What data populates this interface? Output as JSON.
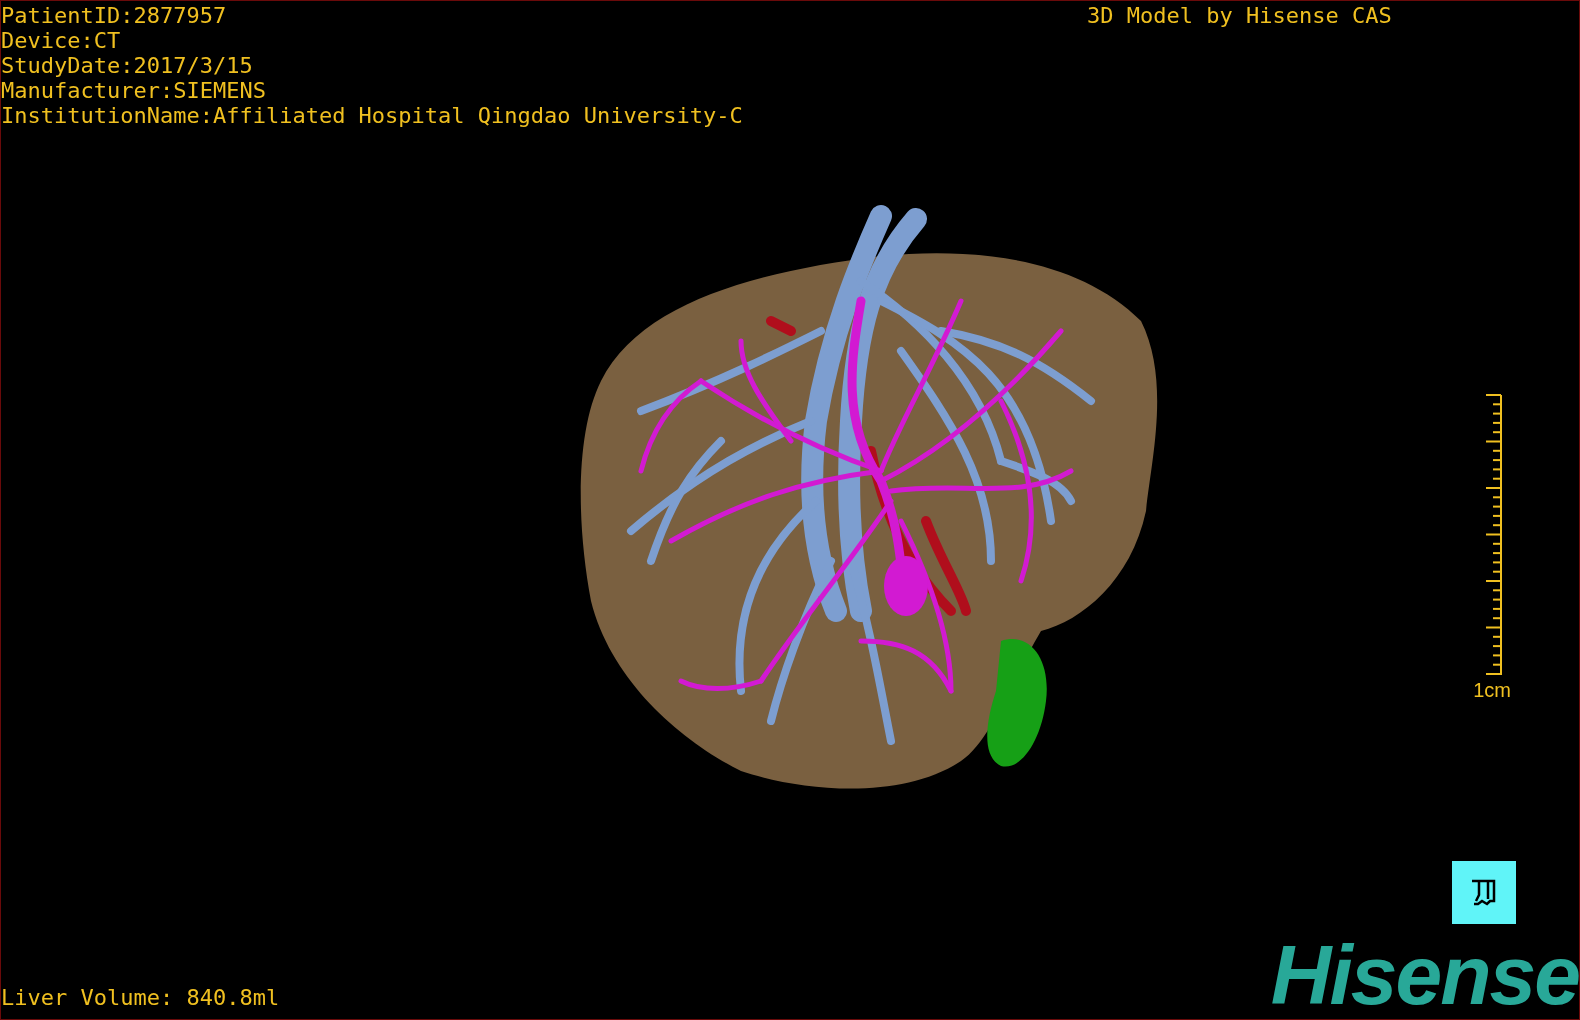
{
  "viewport": {
    "patient_info": [
      "PatientID:2877957",
      "Device:CT",
      "StudyDate:2017/3/15",
      "Manufacturer:SIEMENS",
      "InstitutionName:Affiliated Hospital Qingdao University-C"
    ],
    "credit": "3D Model by Hisense CAS",
    "scale_bar": {
      "label": "1cm"
    },
    "liver_volume": "Liver Volume: 840.8ml",
    "logo": "Hisense"
  }
}
